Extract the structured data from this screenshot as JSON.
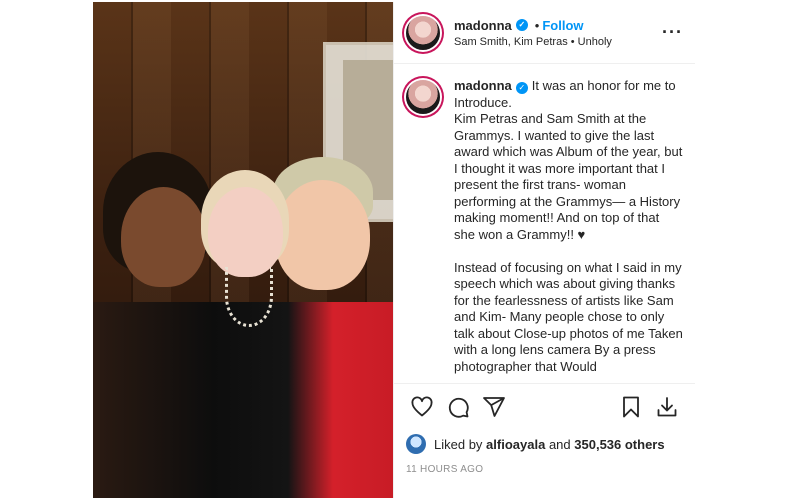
{
  "post": {
    "author": "madonna",
    "follow_label": "Follow",
    "separator": "•",
    "audio": "Sam Smith, Kim Petras • Unholy",
    "caption_author": "madonna",
    "caption_text": "It was an honor for me to Introduce.\nKim Petras and Sam Smith at the Grammys. I wanted to give the last award which was Album of the year, but I thought it was more important that I present the first trans- woman performing at the Grammys— a History making moment!! And on top of that she won a Grammy!! ♥\n\nInstead of focusing on what I said in my speech which was about giving thanks for the fearlessness of artists like Sam and Kim- Many people chose to only talk about Close-up photos of me Taken with a long lens camera By a press photographer that Would",
    "likes_prefix": "Liked by ",
    "liked_by_user": "alfioayala",
    "likes_mid": " and ",
    "likes_count": "350,536 others",
    "timestamp": "11 HOURS AGO"
  },
  "icons": {
    "verified": "verified-badge-icon",
    "more": "more-options-icon",
    "like": "heart-icon",
    "comment": "comment-icon",
    "share": "share-icon",
    "save": "bookmark-icon",
    "download": "download-icon"
  },
  "colors": {
    "accent": "#0095f6",
    "text": "#262626",
    "muted": "#8e8e8e",
    "story_ring": "#c8155b"
  }
}
